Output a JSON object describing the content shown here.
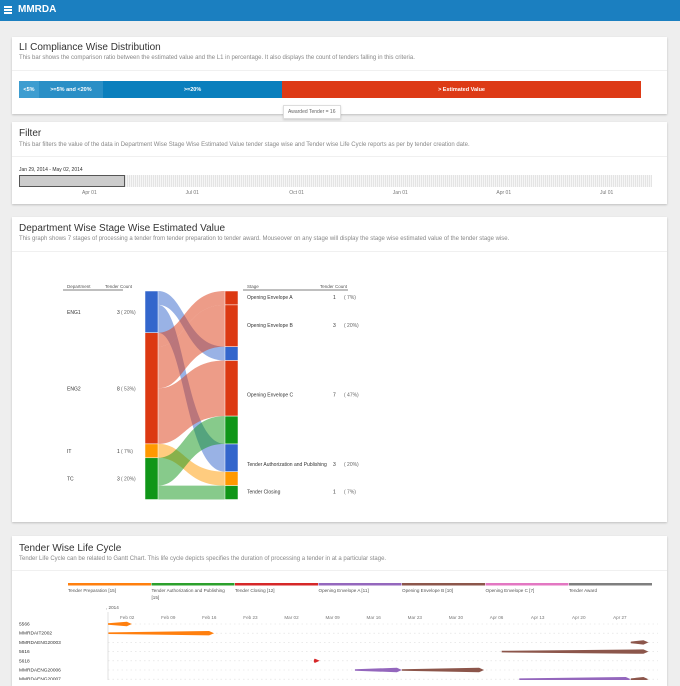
{
  "header": {
    "title": "MMRDA",
    "menu_icon": "hamburger-icon",
    "color": "#1b7fc0"
  },
  "l1": {
    "title": "LI Compliance Wise Distribution",
    "description": "This bar shows the comparison ratio between the estimated value and the L1 in percentage. It also displays the count of tenders falling in this criteria.",
    "segments": [
      {
        "label": "<5%",
        "share": 3.2,
        "color": "#3d9dd0"
      },
      {
        "label": ">=5% and <20%",
        "share": 10.3,
        "color": "#2a8fc6"
      },
      {
        "label": ">=20%",
        "share": 28.8,
        "color": "#0a7fbd"
      },
      {
        "label": "> Estimated Value",
        "share": 57.7,
        "color": "#dd3a16"
      }
    ],
    "tooltip": "Awarded Tender = 16"
  },
  "filter": {
    "title": "Filter",
    "description": "This bar filters the value of the data in Department Wise Stage Wise Estimated Value tender stage wise and Tender wise Life Cycle reports as per by tender creation date.",
    "range_label": "Jan 29, 2014 - May 02, 2014",
    "ticks": [
      "Apr 01",
      "Jul 01",
      "Oct 01",
      "Jan 01",
      "Apr 01",
      "Jul 01"
    ]
  },
  "dept": {
    "title": "Department Wise Stage Wise Estimated Value",
    "description": "This graph shows 7 stages of processing a tender from tender preparation to tender award. Mouseover on any stage will display the stage wise estimated value of the tender stage wise.",
    "left_headers": [
      "Department",
      "Tender Count"
    ],
    "right_headers": [
      "Stage",
      "Tender Count"
    ],
    "departments": [
      {
        "name": "ENG1",
        "count": "3",
        "pct": "( 20%)",
        "color": "#3366cc"
      },
      {
        "name": "ENG2",
        "count": "8",
        "pct": "( 53%)",
        "color": "#dc3912"
      },
      {
        "name": "IT",
        "count": "1",
        "pct": "( 7%)",
        "color": "#ff9900"
      },
      {
        "name": "TC",
        "count": "3",
        "pct": "( 20%)",
        "color": "#109618"
      }
    ],
    "stages": [
      {
        "name": "Opening Envelope A",
        "count": "1",
        "pct": "( 7%)"
      },
      {
        "name": "Opening Envelope B",
        "count": "3",
        "pct": "( 20%)"
      },
      {
        "name": "Opening Envelope C",
        "count": "7",
        "pct": "( 47%)"
      },
      {
        "name": "Tender Authorization and Publishing",
        "count": "3",
        "pct": "( 20%)"
      },
      {
        "name": "Tender Closing",
        "count": "1",
        "pct": "( 7%)"
      }
    ],
    "flows": [
      {
        "from": 0,
        "to": 2,
        "value": 1
      },
      {
        "from": 0,
        "to": 3,
        "value": 2
      },
      {
        "from": 1,
        "to": 0,
        "value": 1
      },
      {
        "from": 1,
        "to": 1,
        "value": 3
      },
      {
        "from": 1,
        "to": 2,
        "value": 4
      },
      {
        "from": 2,
        "to": 3,
        "value": 1
      },
      {
        "from": 3,
        "to": 2,
        "value": 2
      },
      {
        "from": 3,
        "to": 4,
        "value": 1
      }
    ]
  },
  "life": {
    "title": "Tender Wise Life Cycle",
    "description": "Tender Life Cycle can be related to Gantt Chart. This life cycle depicts specifies the duration of processing a tender in at a particular stage.",
    "legend": [
      {
        "label": "Tender Preparation [15]",
        "color": "#ff7f0e"
      },
      {
        "label": "Tender Authorization and Publishing [15]",
        "color": "#2ca02c"
      },
      {
        "label": "Tender Closing [12]",
        "color": "#d62728"
      },
      {
        "label": "Opening Envelope A [11]",
        "color": "#9467bd"
      },
      {
        "label": "Opening Envelope B [10]",
        "color": "#8c564b"
      },
      {
        "label": "Opening Envelope C [7]",
        "color": "#e377c2"
      },
      {
        "label": "Tender Award",
        "color": "#7f7f7f"
      }
    ],
    "year_label": ", 2014",
    "ticks": [
      "Feb 02",
      "Feb 09",
      "Feb 16",
      "Feb 23",
      "Mar 02",
      "Mar 09",
      "Mar 16",
      "Mar 23",
      "Mar 30",
      "Apr 06",
      "Apr 13",
      "Apr 20",
      "Apr 27"
    ],
    "rows": [
      {
        "name": "5566",
        "bars": [
          {
            "stage": 0,
            "start": "2014-01-29",
            "end": "2014-02-03"
          }
        ]
      },
      {
        "name": "MMRDAIT2002",
        "bars": [
          {
            "stage": 0,
            "start": "2014-01-30",
            "end": "2014-02-17"
          }
        ]
      },
      {
        "name": "MMRDAENG20003",
        "bars": [
          {
            "stage": 4,
            "start": "2014-04-29",
            "end": "2014-05-02"
          }
        ]
      },
      {
        "name": "5616",
        "bars": [
          {
            "stage": 4,
            "start": "2014-04-07",
            "end": "2014-05-02"
          }
        ]
      },
      {
        "name": "5618",
        "bars": [
          {
            "stage": 2,
            "start": "2014-03-06",
            "end": "2014-03-07"
          }
        ]
      },
      {
        "name": "MMRDAENG20006",
        "bars": [
          {
            "stage": 3,
            "start": "2014-03-13",
            "end": "2014-03-21"
          },
          {
            "stage": 4,
            "start": "2014-03-21",
            "end": "2014-04-04"
          }
        ]
      },
      {
        "name": "MMRDAENG20007",
        "bars": [
          {
            "stage": 3,
            "start": "2014-04-10",
            "end": "2014-04-29"
          },
          {
            "stage": 4,
            "start": "2014-04-29",
            "end": "2014-05-02"
          }
        ]
      }
    ]
  }
}
